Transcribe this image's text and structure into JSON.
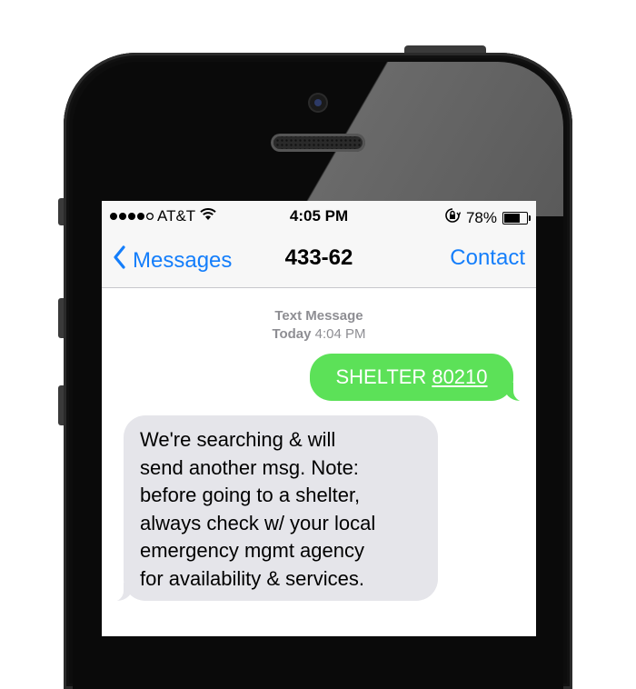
{
  "status_bar": {
    "carrier": "AT&T",
    "time": "4:05 PM",
    "battery_percent": "78%",
    "battery_level": 0.78,
    "signal_bars_filled": 4,
    "signal_bars_total": 5,
    "wifi_icon": "wifi-icon",
    "lock_icon": "orientation-lock-icon"
  },
  "nav": {
    "back_label": "Messages",
    "title": "433-62",
    "contact_label": "Contact"
  },
  "timestamp": {
    "type_label": "Text Message",
    "day": "Today",
    "time": "4:04 PM"
  },
  "messages": {
    "outgoing": {
      "keyword": "SHELTER",
      "zip": "80210"
    },
    "incoming": {
      "lines": [
        "We're searching & will",
        "send another msg. Note:",
        "before going to a shelter,",
        "always check w/ your local",
        "emergency mgmt agency",
        "for availability & services."
      ]
    }
  },
  "colors": {
    "accent": "#147efb",
    "outgoing_bubble": "#5ce158",
    "incoming_bubble": "#e5e5ea"
  }
}
